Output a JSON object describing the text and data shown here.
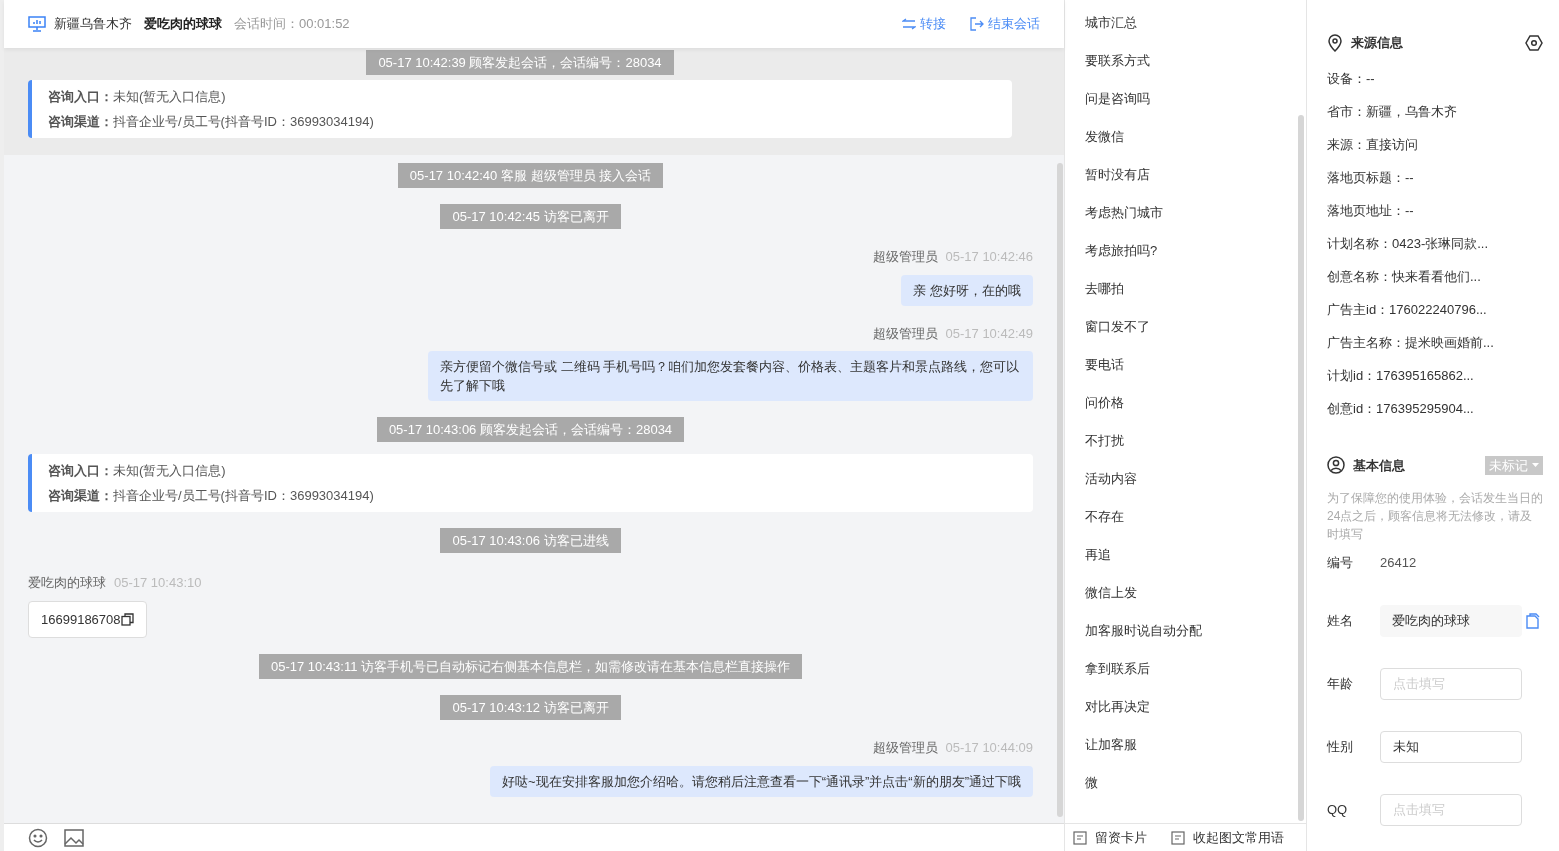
{
  "header": {
    "location": "新疆乌鲁木齐",
    "visitor_name": "爱吃肉的球球",
    "duration": "会话时间：00:01:52",
    "actions": [
      {
        "kind": "transfer",
        "label": "转接"
      },
      {
        "kind": "end",
        "label": "结束会话"
      }
    ]
  },
  "pinned": [
    {
      "kind": "system",
      "text": "05-17 10:42:39 顾客发起会话，会话编号：28034"
    },
    {
      "kind": "info",
      "lines": [
        "**咨询入口：**未知(暂无入口信息)",
        "**咨询渠道：**抖音企业号/员工号(抖音号ID：36993034194)"
      ]
    }
  ],
  "messages": [
    {
      "kind": "system",
      "text": "05-17 10:42:40 客服 超级管理员 接入会话"
    },
    {
      "kind": "system",
      "text": "05-17 10:42:45 访客已离开"
    },
    {
      "kind": "agent",
      "sender": "超级管理员",
      "time": "05-17 10:42:46",
      "text": "亲 您好呀，在的哦"
    },
    {
      "kind": "agent",
      "sender": "超级管理员",
      "time": "05-17 10:42:49",
      "text": "亲方便留个微信号或 二维码 手机号吗？咱们加您发套餐内容、价格表、主题客片和景点路线，您可以先了解下哦"
    },
    {
      "kind": "system",
      "text": "05-17 10:43:06 顾客发起会话，会话编号：28034"
    },
    {
      "kind": "info",
      "lines": [
        "**咨询入口：**未知(暂无入口信息)",
        "**咨询渠道：**抖音企业号/员工号(抖音号ID：36993034194)"
      ]
    },
    {
      "kind": "system",
      "text": "05-17 10:43:06 访客已进线"
    },
    {
      "kind": "visitor",
      "sender": "爱吃肉的球球",
      "time": "05-17 10:43:10",
      "phone": "16699186708"
    },
    {
      "kind": "system",
      "text": "05-17 10:43:11 访客手机号已自动标记右侧基本信息栏，如需修改请在基本信息栏直接操作"
    },
    {
      "kind": "system",
      "text": "05-17 10:43:12 访客已离开"
    },
    {
      "kind": "agent",
      "sender": "超级管理员",
      "time": "05-17 10:44:09",
      "text": "好哒~现在安排客服加您介绍哈。请您稍后注意查看一下“通讯录”并点击“新的朋友”通过下哦"
    }
  ],
  "quick_phrases": [
    "城市汇总",
    "要联系方式",
    "问是咨询吗",
    "发微信",
    "暂时没有店",
    "考虑热门城市",
    "考虑旅拍吗?",
    "去哪拍",
    "窗口发不了",
    "要电话",
    "问价格",
    "不打扰",
    "活动内容",
    "不存在",
    "再追",
    "微信上发",
    "加客服时说自动分配",
    "拿到联系后",
    "对比再决定",
    "让加客服",
    "微"
  ],
  "phrase_actions": [
    "留资卡片",
    "收起图文常用语"
  ],
  "source_info": {
    "title": "来源信息",
    "rows": [
      "设备：--",
      "省市：新疆，乌鲁木齐",
      "来源：直接访问",
      "落地页标题：--",
      "落地页地址：--",
      "计划名称：0423-张琳同款...",
      "创意名称：快来看看他们...",
      "广告主id：176022240796...",
      "广告主名称：提米映画婚前...",
      "计划id：176395165862...",
      "创意id：176395295904..."
    ]
  },
  "basic_info": {
    "title": "基本信息",
    "tag": "未标记",
    "note": "为了保障您的使用体验，会话发生当日的24点之后，顾客信息将无法修改，请及时填写",
    "fields": [
      {
        "kind": "text",
        "label": "编号",
        "value": "26412"
      },
      {
        "kind": "filled",
        "label": "姓名",
        "value": "爱吃肉的球球"
      },
      {
        "kind": "input",
        "label": "年龄",
        "placeholder": "点击填写"
      },
      {
        "kind": "input",
        "label": "性别",
        "value": "未知"
      },
      {
        "kind": "input",
        "label": "QQ",
        "placeholder": "点击填写"
      }
    ]
  }
}
